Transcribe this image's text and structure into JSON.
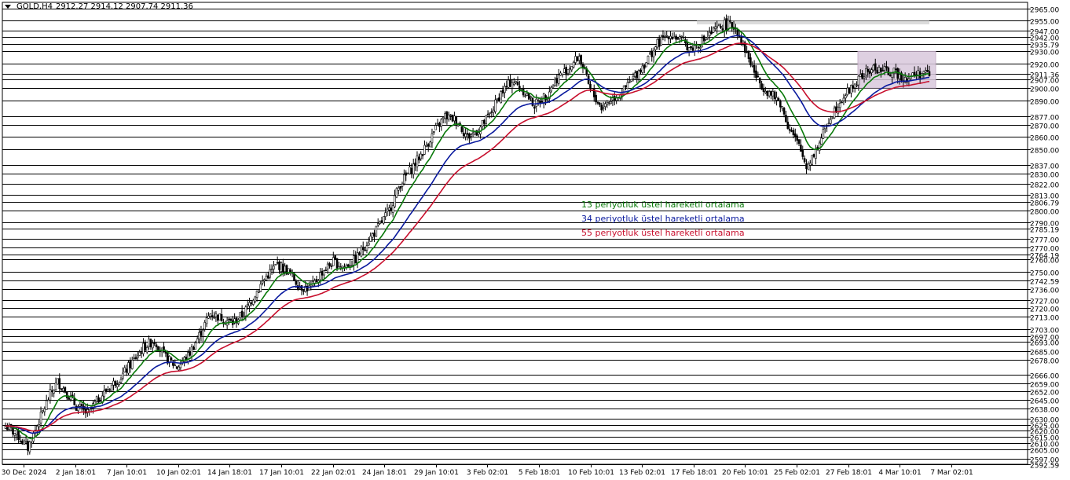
{
  "header": {
    "symbol": "GOLD,H4",
    "ohlc": "2912.27 2914.12 2907.74 2911.36"
  },
  "colors": {
    "background": "#ffffff",
    "grid_level": "#000000",
    "candle": "#000000",
    "ema13": "#0a7a0a",
    "ema34": "#0a1a9e",
    "ema55": "#c8102e",
    "range_box": "#d9c8dc",
    "resistance_band": "#d3d3d3"
  },
  "annotations": [
    {
      "text": "13 periyotluk üstel hareketli ortalama",
      "color": "#0a7a0a"
    },
    {
      "text": "34 periyotluk üstel hareketli ortalama",
      "color": "#0a1a9e"
    },
    {
      "text": "55 periyotluk üstel hareketli ortalama",
      "color": "#c8102e"
    }
  ],
  "chart_data": {
    "type": "candlestick",
    "title": "",
    "ylim": [
      2592.59,
      2970.0
    ],
    "x_ticks": [
      "30 Dec 2024",
      "2 Jan 18:01",
      "7 Jan 10:01",
      "10 Jan 02:01",
      "14 Jan 18:01",
      "17 Jan 10:01",
      "22 Jan 02:01",
      "24 Jan 18:01",
      "29 Jan 10:01",
      "3 Feb 02:01",
      "5 Feb 18:01",
      "10 Feb 10:01",
      "13 Feb 02:01",
      "17 Feb 18:01",
      "20 Feb 10:01",
      "25 Feb 02:01",
      "27 Feb 18:01",
      "4 Mar 10:01",
      "7 Mar 02:01"
    ],
    "price_levels": [
      "2965.00",
      "2955.00",
      "2947.00",
      "2942.00",
      "2935.79",
      "2930.00",
      "2920.00",
      "2911.36",
      "2907.00",
      "2900.00",
      "2890.00",
      "2877.00",
      "2870.00",
      "2860.00",
      "2850.00",
      "2837.00",
      "2830.00",
      "2822.00",
      "2813.00",
      "2806.79",
      "2800.00",
      "2790.00",
      "2785.19",
      "2777.00",
      "2770.00",
      "2764.19",
      "2760.00",
      "2750.00",
      "2742.59",
      "2736.00",
      "2727.00",
      "2720.00",
      "2713.00",
      "2703.00",
      "2697.00",
      "2693.00",
      "2685.00",
      "2678.00",
      "2666.00",
      "2659.00",
      "2652.00",
      "2645.00",
      "2638.00",
      "2630.00",
      "2625.00",
      "2620.00",
      "2615.00",
      "2610.00",
      "2605.00",
      "2597.00",
      "2592.59"
    ],
    "close_path": [
      [
        0,
        2624
      ],
      [
        6,
        2617
      ],
      [
        12,
        2606
      ],
      [
        18,
        2628
      ],
      [
        24,
        2650
      ],
      [
        28,
        2660
      ],
      [
        32,
        2653
      ],
      [
        38,
        2640
      ],
      [
        44,
        2634
      ],
      [
        50,
        2646
      ],
      [
        56,
        2656
      ],
      [
        62,
        2664
      ],
      [
        68,
        2676
      ],
      [
        74,
        2688
      ],
      [
        80,
        2694
      ],
      [
        86,
        2680
      ],
      [
        92,
        2672
      ],
      [
        98,
        2681
      ],
      [
        104,
        2698
      ],
      [
        110,
        2716
      ],
      [
        116,
        2712
      ],
      [
        122,
        2708
      ],
      [
        128,
        2716
      ],
      [
        134,
        2732
      ],
      [
        140,
        2746
      ],
      [
        146,
        2756
      ],
      [
        152,
        2750
      ],
      [
        158,
        2738
      ],
      [
        164,
        2736
      ],
      [
        170,
        2750
      ],
      [
        176,
        2758
      ],
      [
        182,
        2754
      ],
      [
        188,
        2760
      ],
      [
        194,
        2774
      ],
      [
        200,
        2786
      ],
      [
        206,
        2800
      ],
      [
        212,
        2822
      ],
      [
        218,
        2834
      ],
      [
        224,
        2848
      ],
      [
        230,
        2864
      ],
      [
        236,
        2877
      ],
      [
        242,
        2874
      ],
      [
        248,
        2860
      ],
      [
        254,
        2866
      ],
      [
        260,
        2878
      ],
      [
        266,
        2896
      ],
      [
        272,
        2906
      ],
      [
        278,
        2898
      ],
      [
        284,
        2886
      ],
      [
        290,
        2894
      ],
      [
        296,
        2908
      ],
      [
        302,
        2916
      ],
      [
        308,
        2926
      ],
      [
        314,
        2898
      ],
      [
        320,
        2884
      ],
      [
        326,
        2892
      ],
      [
        332,
        2898
      ],
      [
        338,
        2910
      ],
      [
        344,
        2922
      ],
      [
        350,
        2936
      ],
      [
        356,
        2944
      ],
      [
        362,
        2940
      ],
      [
        368,
        2932
      ],
      [
        374,
        2938
      ],
      [
        380,
        2946
      ],
      [
        386,
        2952
      ],
      [
        392,
        2950
      ],
      [
        398,
        2928
      ],
      [
        404,
        2906
      ],
      [
        410,
        2896
      ],
      [
        416,
        2888
      ],
      [
        420,
        2870
      ],
      [
        426,
        2852
      ],
      [
        430,
        2836
      ],
      [
        436,
        2852
      ],
      [
        442,
        2874
      ],
      [
        448,
        2890
      ],
      [
        454,
        2900
      ],
      [
        460,
        2910
      ],
      [
        466,
        2916
      ],
      [
        472,
        2914
      ],
      [
        478,
        2912
      ],
      [
        484,
        2908
      ],
      [
        490,
        2912
      ],
      [
        496,
        2911.36
      ]
    ],
    "series": [
      {
        "name": "13 periyotluk üstel hareketli ortalama",
        "period": 13,
        "color": "#0a7a0a"
      },
      {
        "name": "34 periyotluk üstel hareketli ortalama",
        "period": 34,
        "color": "#0a1a9e"
      },
      {
        "name": "55 periyotluk üstel hareketli ortalama",
        "period": 55,
        "color": "#c8102e"
      }
    ],
    "range_box": {
      "y_top": 2930.0,
      "y_bottom": 2900.0
    },
    "resistance_band": {
      "y_top": 2955.0,
      "y_bottom": 2952.0
    },
    "legend": "none",
    "grid": false
  }
}
